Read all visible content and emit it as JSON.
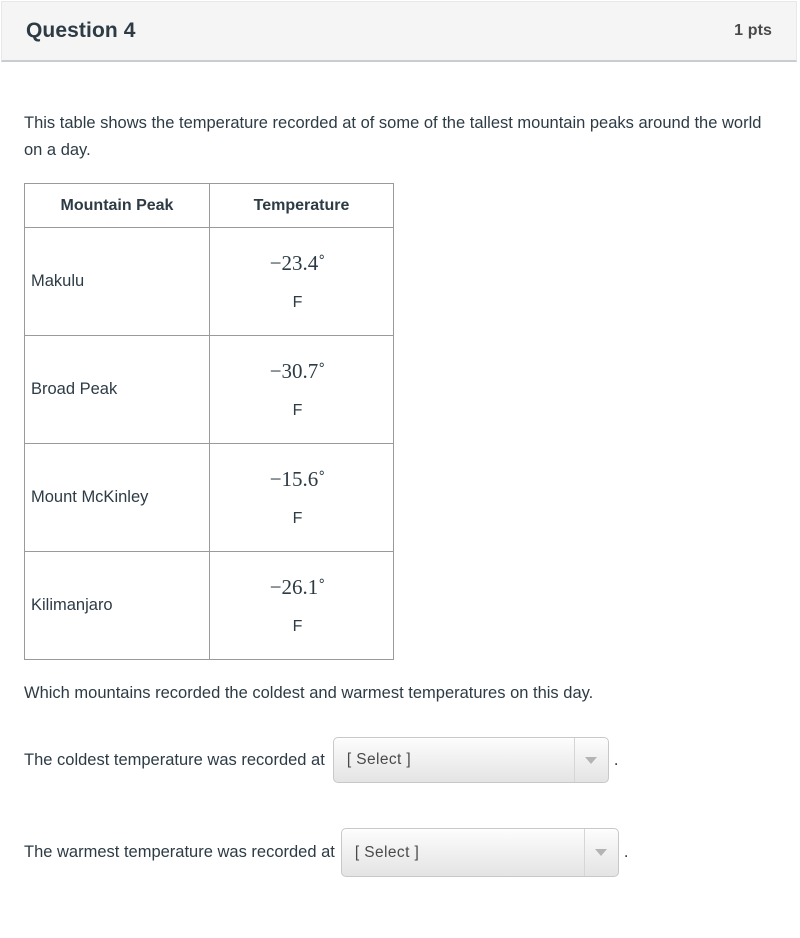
{
  "header": {
    "title": "Question 4",
    "points": "1 pts"
  },
  "body": {
    "intro": "This table shows the temperature recorded at of some of the tallest mountain peaks around the world on a day.",
    "prompt": "Which mountains recorded the coldest and warmest temperatures on this day."
  },
  "table": {
    "columns": [
      "Mountain Peak",
      "Temperature"
    ],
    "rows": [
      {
        "peak": "Makulu",
        "value": "−23.4˚",
        "unit": "F"
      },
      {
        "peak": "Broad Peak",
        "value": "−30.7˚",
        "unit": "F"
      },
      {
        "peak": "Mount McKinley",
        "value": "−15.6˚",
        "unit": "F"
      },
      {
        "peak": "Kilimanjaro",
        "value": "−26.1˚",
        "unit": "F"
      }
    ]
  },
  "answers": {
    "coldest": {
      "label": "The coldest temperature was recorded at",
      "selected": "[ Select ]",
      "trailing": "."
    },
    "warmest": {
      "label": "The warmest temperature was recorded at",
      "selected": "[ Select ]",
      "trailing": "."
    }
  },
  "colors": {
    "header_bg": "#f5f5f5",
    "header_border": "#c7cdd1",
    "text": "#2d3b45",
    "table_border": "#9a9a9a",
    "select_border": "#c8c8c8",
    "arrow": "#b4b4b4"
  }
}
